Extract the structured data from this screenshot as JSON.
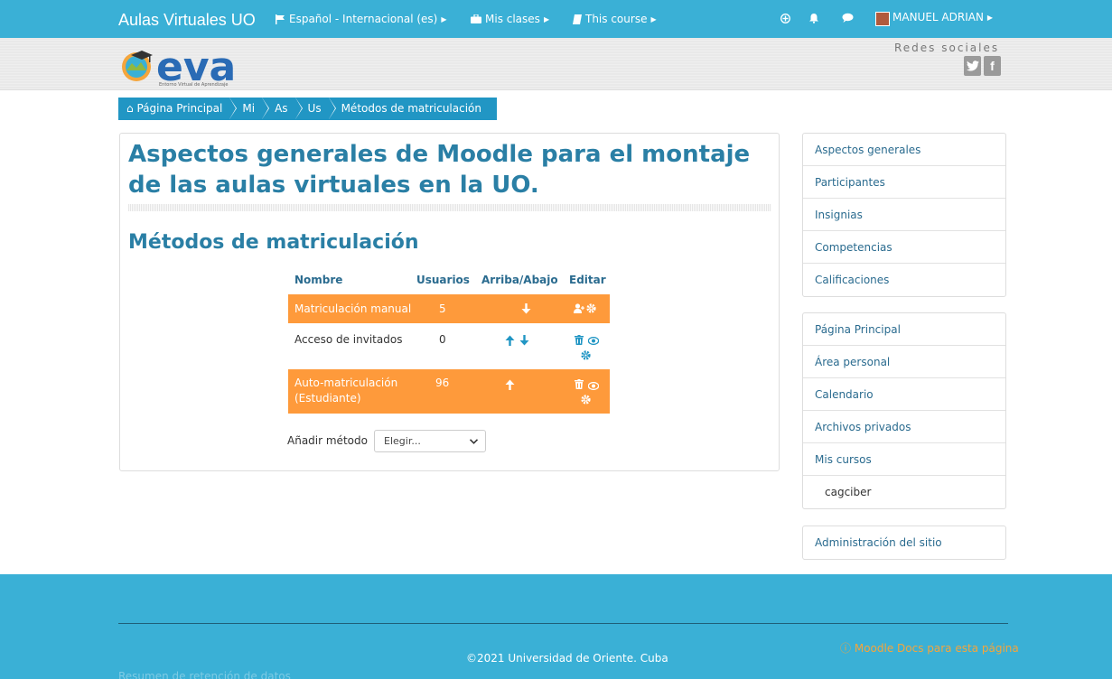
{
  "navbar": {
    "brand": "Aulas Virtuales UO",
    "language": "Español - Internacional (es)",
    "my_classes": "Mis clases",
    "this_course": "This course",
    "user_name": "MANUEL ADRIAN"
  },
  "header": {
    "logo_text": "eva",
    "logo_subtitle": "Entorno Virtual de Aprendizaje",
    "social_title": "Redes sociales"
  },
  "breadcrumb": [
    "Página Principal",
    "Mi",
    "As",
    "Us",
    "Métodos de matriculación"
  ],
  "main": {
    "course_title": "Aspectos generales de Moodle para el montaje de las aulas virtuales en la UO.",
    "section_title": "Métodos de matriculación",
    "table": {
      "headers": [
        "Nombre",
        "Usuarios",
        "Arriba/Abajo",
        "Editar"
      ],
      "rows": [
        {
          "name": "Matriculación manual",
          "users": "5"
        },
        {
          "name": "Acceso de invitados",
          "users": "0"
        },
        {
          "name_line1": "Auto-matriculación",
          "name_line2": "(Estudiante)",
          "users": "96"
        }
      ]
    },
    "add_method_label": "Añadir método",
    "add_method_select": "Elegir..."
  },
  "sidebar": {
    "course_nav": [
      "Aspectos generales",
      "Participantes",
      "Insignias",
      "Competencias",
      "Calificaciones"
    ],
    "site_nav": [
      "Página Principal",
      "Área personal",
      "Calendario",
      "Archivos privados",
      "Mis cursos",
      "cagciber"
    ],
    "admin": "Administración del sitio"
  },
  "footer": {
    "copyright": "©2021 Universidad de Oriente. Cuba",
    "docs_link": "Moodle Docs para esta página",
    "retention": "Resumen de retención de datos"
  },
  "colors": {
    "primary": "#3ab0d6",
    "breadcrumb": "#2196c4",
    "accent_orange": "#fe9a3b",
    "title_blue": "#2a7fa5"
  }
}
